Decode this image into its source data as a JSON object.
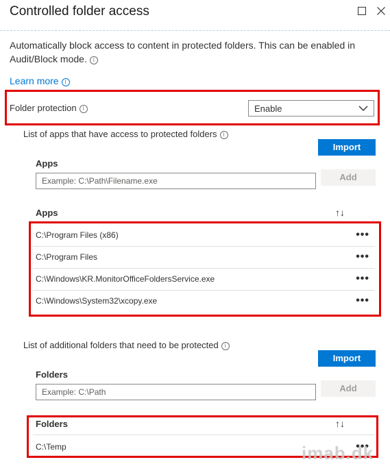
{
  "header": {
    "title": "Controlled folder access"
  },
  "description": "Automatically block access to content in protected folders. This can be enabled in Audit/Block mode.",
  "learn_more": "Learn more",
  "folder_protection": {
    "label": "Folder protection",
    "value": "Enable"
  },
  "apps_section": {
    "caption": "List of apps that have access to protected folders",
    "import_label": "Import",
    "input_label": "Apps",
    "input_placeholder": "Example: C:\\Path\\Filename.exe",
    "add_label": "Add",
    "list_header": "Apps",
    "items": [
      "C:\\Program Files (x86)",
      "C:\\Program Files",
      "C:\\Windows\\KR.MonitorOfficeFoldersService.exe",
      "C:\\Windows\\System32\\xcopy.exe"
    ]
  },
  "folders_section": {
    "caption": "List of additional folders that need to be protected",
    "import_label": "Import",
    "input_label": "Folders",
    "input_placeholder": "Example: C:\\Path",
    "add_label": "Add",
    "list_header": "Folders",
    "items": [
      "C:\\Temp"
    ]
  },
  "icons": {
    "maximize": "maximize-icon",
    "close": "close-icon",
    "info": "info-icon",
    "chevron": "chevron-down-icon",
    "sort": "sort-icon",
    "more": "more-icon"
  },
  "glyphs": {
    "info": "i",
    "sort": "↑↓",
    "more": "•••"
  },
  "watermark": "imab.dk",
  "colors": {
    "accent": "#0078d4",
    "highlight_border": "#e10000"
  }
}
